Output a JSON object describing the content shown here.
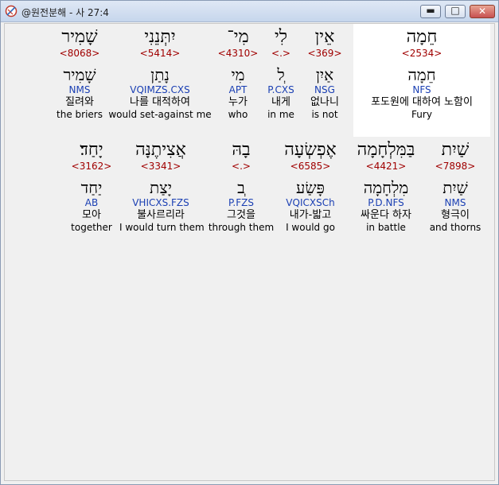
{
  "window": {
    "title": "@원전분해 - 사 27:4",
    "controls": {
      "minimize": "▬",
      "maximize": "□",
      "close": "✕"
    }
  },
  "rows": [
    {
      "words": [
        {
          "heb": "חֵמָה",
          "strong": "<2534>",
          "lemma": "חֵמָה",
          "parse": "NFS",
          "kor": "포도원에 대하여 노함이",
          "eng": "Fury",
          "highlighted": true
        },
        {
          "heb": "אֵין",
          "strong": "<369>",
          "lemma": "אַיִן",
          "parse": "NSG",
          "kor": "없나니",
          "eng": "is not"
        },
        {
          "heb": "לִי",
          "strong": "<.>",
          "lemma": "ְל",
          "parse": "P.CXS",
          "kor": "내게",
          "eng": "in me"
        },
        {
          "heb": "מִי־",
          "strong": "<4310>",
          "lemma": "מִי",
          "parse": "APT",
          "kor": "누가",
          "eng": "who"
        },
        {
          "heb": "יִתְּנֵנִי",
          "strong": "<5414>",
          "lemma": "נָתַן",
          "parse": "VQIMZS.CXS",
          "kor": "나를 대적하여",
          "eng": "would set-against me"
        },
        {
          "heb": "שָׁמִיר",
          "strong": "<8068>",
          "lemma": "שָׁמִיר",
          "parse": "NMS",
          "kor": "질려와",
          "eng": "the briers"
        }
      ]
    },
    {
      "words": [
        {
          "heb": "שַׁיִת",
          "strong": "<7898>",
          "lemma": "שַׁיִת",
          "parse": "NMS",
          "kor": "형극이",
          "eng": "and thorns"
        },
        {
          "heb": "בַּמִּלְחָמָה",
          "strong": "<4421>",
          "lemma": "מִלְחָמָה",
          "parse": "P.D.NFS",
          "kor": "싸운다 하자",
          "eng": "in battle"
        },
        {
          "heb": "אֶפְשְׂעָה",
          "strong": "<6585>",
          "lemma": "פָּשַׂע",
          "parse": "VQICXSCh",
          "kor": "내가-밟고",
          "eng": "I would go"
        },
        {
          "heb": "בָהּ",
          "strong": "<.>",
          "lemma": "ְב",
          "parse": "P.FZS",
          "kor": "그것을",
          "eng": "through them"
        },
        {
          "heb": "אֲצִיתֶנָּה",
          "strong": "<3341>",
          "lemma": "יָצַת",
          "parse": "VHICXS.FZS",
          "kor": "불사르리라",
          "eng": "I would turn them"
        },
        {
          "heb": "יָחַד׃",
          "strong": "<3162>",
          "lemma": "יַחַד",
          "parse": "AB",
          "kor": "모아",
          "eng": "together"
        }
      ]
    }
  ]
}
